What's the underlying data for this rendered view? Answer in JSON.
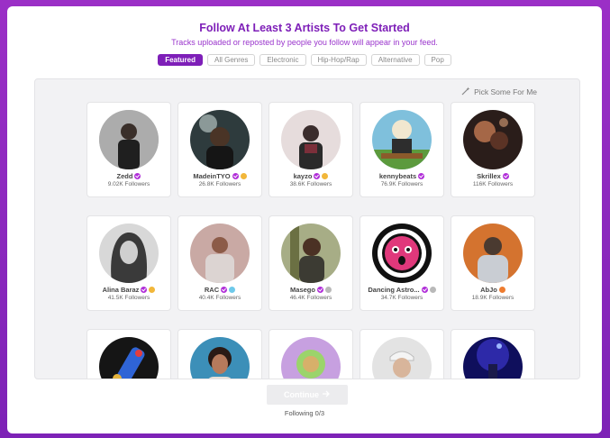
{
  "header": {
    "title": "Follow At Least 3 Artists To Get Started",
    "subtitle": "Tracks uploaded or reposted by people you follow will appear in your feed."
  },
  "tabs": [
    {
      "label": "Featured",
      "active": true
    },
    {
      "label": "All Genres",
      "active": false
    },
    {
      "label": "Electronic",
      "active": false
    },
    {
      "label": "Hip-Hop/Rap",
      "active": false
    },
    {
      "label": "Alternative",
      "active": false
    },
    {
      "label": "Pop",
      "active": false
    }
  ],
  "pick_some": {
    "label": "Pick Some For Me",
    "icon": "magic-wand-icon"
  },
  "artists": [
    {
      "name": "Zedd",
      "followers": "9.02K Followers",
      "badges": [
        "verified"
      ]
    },
    {
      "name": "MadeinTYO",
      "followers": "26.8K Followers",
      "badges": [
        "verified",
        "gold"
      ]
    },
    {
      "name": "kayzo",
      "followers": "38.6K Followers",
      "badges": [
        "verified",
        "gold"
      ]
    },
    {
      "name": "kennybeats",
      "followers": "76.9K Followers",
      "badges": [
        "verified"
      ]
    },
    {
      "name": "Skrillex",
      "followers": "116K Followers",
      "badges": [
        "verified"
      ]
    },
    {
      "name": "Alina Baraz",
      "followers": "41.5K Followers",
      "badges": [
        "verified",
        "gold"
      ]
    },
    {
      "name": "RAC",
      "followers": "40.4K Followers",
      "badges": [
        "verified",
        "blue"
      ]
    },
    {
      "name": "Masego",
      "followers": "46.4K Followers",
      "badges": [
        "verified",
        "gray"
      ]
    },
    {
      "name": "Dancing Astro...",
      "followers": "34.7K Followers",
      "badges": [
        "verified",
        "gray"
      ]
    },
    {
      "name": "AbJo",
      "followers": "18.9K Followers",
      "badges": [
        "orange"
      ]
    },
    {
      "name": "",
      "followers": "",
      "badges": []
    },
    {
      "name": "",
      "followers": "",
      "badges": []
    },
    {
      "name": "",
      "followers": "",
      "badges": []
    },
    {
      "name": "",
      "followers": "",
      "badges": []
    },
    {
      "name": "",
      "followers": "",
      "badges": []
    }
  ],
  "footer": {
    "continue_label": "Continue",
    "following_status": "Following 0/3"
  },
  "colors": {
    "accent": "#7e1fb8",
    "frame": "#9b2fc6",
    "verified": "#b12fd9"
  }
}
